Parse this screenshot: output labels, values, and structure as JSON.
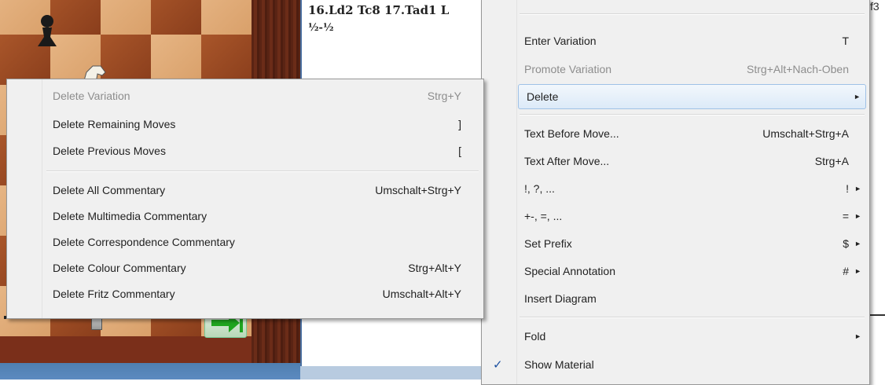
{
  "notation": {
    "line1": "16.Ld2 Tc8 17.Tad1 L",
    "line2": "½-½"
  },
  "far_right_text": "f3",
  "main_menu": {
    "items": [
      {
        "label": "Enter Variation",
        "shortcut": "T",
        "disabled": false
      },
      {
        "label": "Promote Variation",
        "shortcut": "Strg+Alt+Nach-Oben",
        "disabled": true
      },
      {
        "label": "Delete",
        "shortcut": "",
        "submenu": true,
        "highlighted": true
      },
      {
        "label": "Text Before Move...",
        "shortcut": "Umschalt+Strg+A"
      },
      {
        "label": "Text After Move...",
        "shortcut": "Strg+A"
      },
      {
        "label": "!, ?, ...",
        "shortcut": "!"
      },
      {
        "label": "+-, =, ...",
        "shortcut": "="
      },
      {
        "label": "Set Prefix",
        "shortcut": "$"
      },
      {
        "label": "Special Annotation",
        "shortcut": "#"
      },
      {
        "label": "Insert Diagram",
        "shortcut": ""
      },
      {
        "label": "Fold",
        "shortcut": ""
      },
      {
        "label": "Show Material",
        "shortcut": "",
        "checked": true
      }
    ]
  },
  "delete_submenu": {
    "items": [
      {
        "label": "Delete Variation",
        "shortcut": "Strg+Y",
        "disabled": true
      },
      {
        "label": "Delete Remaining Moves",
        "shortcut": "]"
      },
      {
        "label": "Delete Previous Moves",
        "shortcut": "["
      },
      {
        "label": "Delete All Commentary",
        "shortcut": "Umschalt+Strg+Y"
      },
      {
        "label": "Delete Multimedia Commentary",
        "shortcut": ""
      },
      {
        "label": "Delete Correspondence Commentary",
        "shortcut": ""
      },
      {
        "label": "Delete Colour Commentary",
        "shortcut": "Strg+Alt+Y"
      },
      {
        "label": "Delete Fritz Commentary",
        "shortcut": "Umschalt+Alt+Y"
      }
    ]
  },
  "icons": {
    "check": "✓",
    "submenu_arrow": "►"
  },
  "colors": {
    "highlight_border": "#9fc1e6",
    "menu_bg": "#f0f0f0",
    "disabled_text": "#8d8d8d"
  }
}
